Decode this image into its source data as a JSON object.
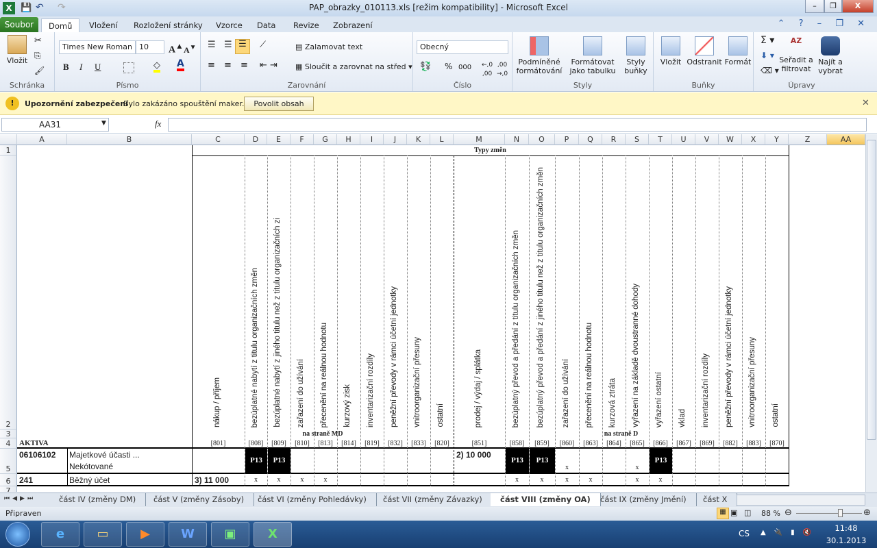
{
  "window": {
    "title": "PAP_obrazky_010113.xls  [režim kompatibility]  -  Microsoft Excel"
  },
  "ribbon_tabs": [
    "Domů",
    "Vložení",
    "Rozložení stránky",
    "Vzorce",
    "Data",
    "Revize",
    "Zobrazení"
  ],
  "file_tab": "Soubor",
  "ribbon": {
    "clipboard": {
      "label": "Schránka",
      "paste": "Vložit"
    },
    "font": {
      "label": "Písmo",
      "font_name": "Times New Roman",
      "font_size": "10",
      "bold": "B",
      "italic": "I",
      "underline": "U"
    },
    "alignment": {
      "label": "Zarovnání",
      "wrap": "Zalamovat text",
      "merge": "Sloučit a zarovnat na střed"
    },
    "number": {
      "label": "Číslo",
      "format": "Obecný",
      "percent": "%",
      "thousands": "000"
    },
    "styles": {
      "label": "Styly",
      "conditional": "Podmíněné formátování",
      "table": "Formátovat jako tabulku",
      "cell_styles": "Styly buňky"
    },
    "cells": {
      "label": "Buňky",
      "insert": "Vložit",
      "delete": "Odstranit",
      "format": "Formát"
    },
    "editing": {
      "label": "Úpravy",
      "sort": "Seřadit a filtrovat",
      "find": "Najít a vybrat"
    }
  },
  "security_bar": {
    "title": "Upozornění zabezpečení",
    "message": "Bylo zakázáno spouštění maker.",
    "button": "Povolit obsah"
  },
  "formula_bar": {
    "name_box": "AA31",
    "fx": "fx",
    "value": ""
  },
  "columns": [
    "A",
    "B",
    "C",
    "D",
    "E",
    "F",
    "G",
    "H",
    "I",
    "J",
    "K",
    "L",
    "M",
    "N",
    "O",
    "P",
    "Q",
    "R",
    "S",
    "T",
    "U",
    "V",
    "W",
    "X",
    "Y",
    "Z",
    "AA"
  ],
  "rows": [
    "1",
    "2",
    "3",
    "4",
    "5",
    "6",
    "7"
  ],
  "sheet": {
    "group_title": "Typy změn",
    "side_md": "na straně MD",
    "side_d": "na straně D",
    "aktiva": "AKTIVA",
    "headers": [
      {
        "col": "C",
        "text": "nákup / příjem",
        "code": "[801]"
      },
      {
        "col": "D",
        "text": "bezúplatné nabytí z titulu organizačních změn",
        "code": "[808]"
      },
      {
        "col": "E",
        "text": "bezúplatné nabytí z jiného titulu než z titulu organizačních zi",
        "code": "[809]"
      },
      {
        "col": "F",
        "text": "zařazení do užívání",
        "code": "[810]"
      },
      {
        "col": "G",
        "text": "přecenění na reálnou hodnotu",
        "code": "[813]"
      },
      {
        "col": "H",
        "text": "kurzový zisk",
        "code": "[814]"
      },
      {
        "col": "I",
        "text": "inventarizační rozdíly",
        "code": "[819]"
      },
      {
        "col": "J",
        "text": "peněžní převody v rámci účetní jednotky",
        "code": "[832]"
      },
      {
        "col": "K",
        "text": "vnitroorganizační přesuny",
        "code": "[833]"
      },
      {
        "col": "L",
        "text": "ostatní",
        "code": "[820]"
      },
      {
        "col": "M",
        "text": "prodej / výdaj / splátka",
        "code": "[851]"
      },
      {
        "col": "N",
        "text": "bezúplatný převod a předání z titulu organizačních změn",
        "code": "[858]"
      },
      {
        "col": "O",
        "text": "bezúplatný převod a předání z jiného titulu než z titulu organizačních změn",
        "code": "[859]"
      },
      {
        "col": "P",
        "text": "zařazení do užívání",
        "code": "[860]"
      },
      {
        "col": "Q",
        "text": "přecenění na reálnou hodnotu",
        "code": "[863]"
      },
      {
        "col": "R",
        "text": "kurzová ztráta",
        "code": "[864]"
      },
      {
        "col": "S",
        "text": "vyřazení na základě dvoustranné dohody",
        "code": "[865]"
      },
      {
        "col": "T",
        "text": "vyřazení ostatní",
        "code": "[866]"
      },
      {
        "col": "U",
        "text": "vklad",
        "code": "[867]"
      },
      {
        "col": "V",
        "text": "inventarizační rozdíly",
        "code": "[869]"
      },
      {
        "col": "W",
        "text": "peněžní převody v rámci účetní jednotky",
        "code": "[882]"
      },
      {
        "col": "X",
        "text": "vnitroorganizační přesuny",
        "code": "[883]"
      },
      {
        "col": "Y",
        "text": "ostatní",
        "code": "[870]"
      }
    ],
    "data_rows": [
      {
        "row": "5",
        "account": "06106102",
        "name_line1": "Majetkové účasti ...",
        "name_line2": "Nekótované",
        "C": "",
        "M": "2) 10 000",
        "black": [
          "D",
          "E",
          "N",
          "O",
          "T"
        ],
        "black_text": "P13",
        "x": [
          "P",
          "S"
        ]
      },
      {
        "row": "6",
        "account": "241",
        "name_line1": "Běžný účet",
        "C": "3) 11 000",
        "M": "",
        "black": [],
        "black_text": "P13",
        "x": [
          "D",
          "E",
          "F",
          "G",
          "N",
          "O",
          "P",
          "Q",
          "S",
          "T"
        ]
      }
    ],
    "x_mark": "x"
  },
  "sheet_tabs": [
    "část IV (změny DM)",
    "část V (změny Zásoby)",
    "část VI (změny Pohledávky)",
    "část VII (změny Závazky)",
    "část VIII (změny OA)",
    "část IX (změny Jmění)",
    "část X"
  ],
  "active_sheet_tab": "část VIII (změny OA)",
  "status": {
    "ready": "Připraven",
    "zoom": "88 %",
    "zoom_level_percent": 88
  },
  "taskbar": {
    "lang": "CS",
    "time": "11:48",
    "date": "30.1.2013"
  }
}
